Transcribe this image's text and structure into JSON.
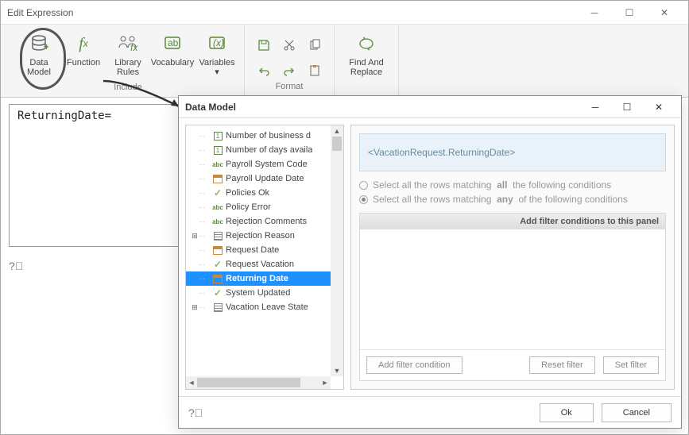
{
  "window": {
    "title": "Edit Expression"
  },
  "ribbon": {
    "items": [
      {
        "label": "Data\nModel"
      },
      {
        "label": "Function"
      },
      {
        "label": "Library\nRules"
      },
      {
        "label": "Vocabulary"
      },
      {
        "label": "Variables\n▾"
      }
    ],
    "group_include": "Include",
    "group_format": "Format",
    "find_replace": "Find And\nReplace"
  },
  "expression": "ReturningDate=",
  "modal": {
    "title": "Data Model",
    "tree": [
      {
        "icon": "num",
        "label": "Number of business d"
      },
      {
        "icon": "num",
        "label": "Number of days availa"
      },
      {
        "icon": "abc",
        "label": "Payroll System Code"
      },
      {
        "icon": "cal",
        "label": "Payroll Update Date"
      },
      {
        "icon": "check",
        "label": "Policies Ok"
      },
      {
        "icon": "abc",
        "label": "Policy Error"
      },
      {
        "icon": "abc",
        "label": "Rejection Comments"
      },
      {
        "icon": "list",
        "label": "Rejection Reason",
        "expandable": true
      },
      {
        "icon": "cal",
        "label": "Request Date"
      },
      {
        "icon": "check",
        "label": "Request Vacation"
      },
      {
        "icon": "cal",
        "label": "Returning Date",
        "selected": true
      },
      {
        "icon": "check",
        "label": "System Updated"
      },
      {
        "icon": "list",
        "label": "Vacation Leave State",
        "expandable": true
      }
    ],
    "preview": "<VacationRequest.ReturningDate>",
    "radio_all_prefix": "Select all the rows matching",
    "radio_all_bold": "all",
    "radio_all_suffix": "the following conditions",
    "radio_any_prefix": "Select all the rows matching",
    "radio_any_bold": "any",
    "radio_any_suffix": "of the following conditions",
    "filter_header": "Add filter conditions to this panel",
    "btn_add_filter": "Add filter condition",
    "btn_reset_filter": "Reset  filter",
    "btn_set_filter": "Set  filter",
    "btn_ok": "Ok",
    "btn_cancel": "Cancel"
  }
}
